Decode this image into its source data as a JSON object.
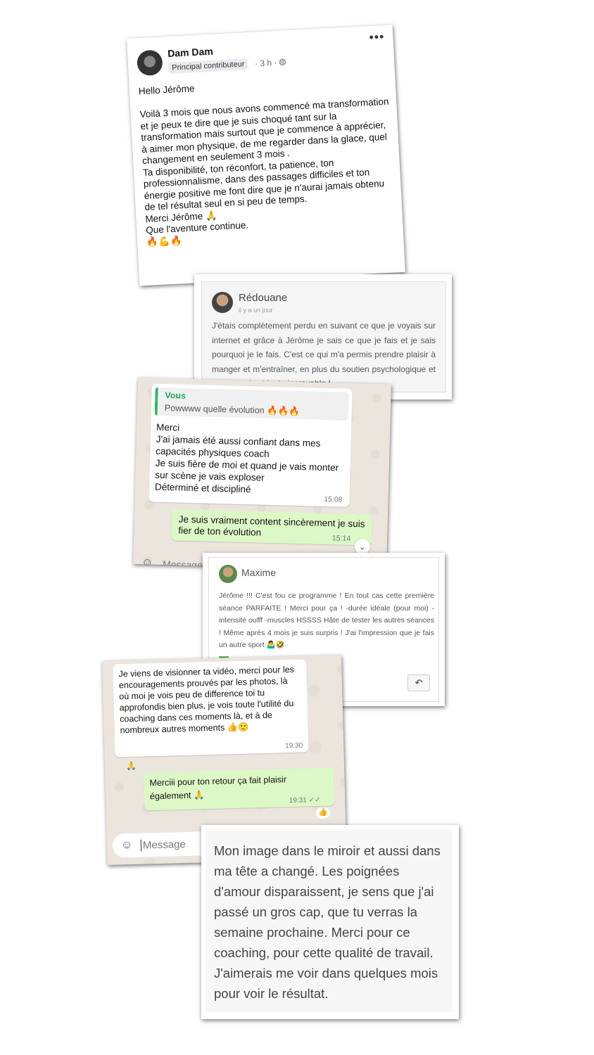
{
  "post": {
    "name": "Dam Dam",
    "badge": "Principal contributeur",
    "time": "· 3 h ·",
    "globe_icon": "globe-icon",
    "more": "•••",
    "text": "Hello Jérôme\n\nVoilà 3 mois que nous avons commencé ma transformation et je peux te dire que je suis choqué tant sur la transformation mais surtout que je commence à apprécier, à aimer mon physique, de me regarder dans la glace, quel changement en seulement 3 mois .\nTa disponibilité, ton réconfort, ta patience, ton professionnalisme,  dans des passages difficiles et ton énergie positive me font dire que je n'aurai jamais obtenu de tel résultat seul en si peu de temps.\nMerci Jérôme 🙏\nQue l'aventure continue.\n🔥💪🔥"
  },
  "review1": {
    "name": "Rédouane",
    "when": "il y a un jour",
    "text": "J'étais complètement perdu en suivant ce que je voyais sur internet et grâce à Jérôme je sais ce que je fais et je sais pourquoi je le fais. C'est ce qui m'a permis prendre plaisir à manger et m'entraîner, en plus du soutien psychologique et le suivi qui est juste incroyable !"
  },
  "chat1": {
    "quote_name": "Vous",
    "quote_text": "Powwww quelle évolution 🔥🔥🔥",
    "msg_in": "Merci\nJ'ai jamais été aussi confiant dans mes capacités physiques coach\nJe suis fière de moi et quand je vais monter sur scène je vais exploser\nDéterminé et discipliné",
    "time_in": "15:08",
    "msg_out": "Je suis vraiment content sincèrement je suis fier de ton évolution",
    "time_out": "15:14",
    "scroll_icon": "⌄",
    "input_placeholder": "Message"
  },
  "review2": {
    "name": "Maxime",
    "text": "Jérôme !!! C'est fou ce programme ! En tout cas cette première séance PARFAITE ! Merci pour ça ! -durée idéale (pour moi) -intensité oufff -muscles HSSSS Hâte de tester les autres séances ! Même après 4 mois je suis surpris ! J'ai l'impression que je fais un autre sport 🤷‍♂️🤣",
    "reply_icon": "↶"
  },
  "chat2": {
    "msg_in": "Je viens de visionner ta vidéo, merci pour les encouragements prouvés par les photos, là où moi je vois peu de difference toi tu approfondis bien plus, je vois toute l'utilité du coaching dans ces moments là, et à de nombreux autres moments 👍🙂",
    "time_in": "19:30",
    "react_in": "🙏",
    "msg_out": "Merciii pour ton retour ça fait plaisir également 🙏",
    "time_out": "19:31 ✓✓",
    "react_out": "👍",
    "input_placeholder": "Message"
  },
  "review3": {
    "text": "Mon image dans le miroir et aussi dans ma tête a changé. Les poignées d'amour disparaissent, je sens que j'ai passé un gros cap, que tu verras la semaine prochaine. Merci pour ce coaching, pour cette qualité de travail. J'aimerais me voir dans quelques mois pour voir le résultat."
  }
}
